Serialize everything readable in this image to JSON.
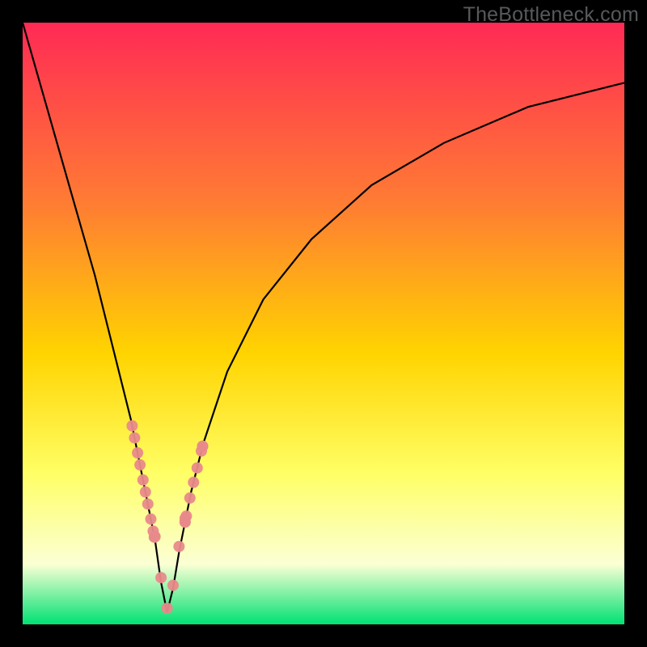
{
  "watermark": "TheBottleneck.com",
  "colors": {
    "top": "#ff2a55",
    "mid_upper": "#ff7c33",
    "mid": "#ffd400",
    "mid_lower": "#ffff66",
    "pale": "#fbffd4",
    "bottom": "#00e173",
    "frame": "#000000",
    "curve": "#000000",
    "dots": "#e98a8a"
  },
  "chart_data": {
    "type": "line",
    "title": "",
    "xlabel": "",
    "ylabel": "",
    "xlim": [
      0,
      100
    ],
    "ylim": [
      0,
      100
    ],
    "notch_x": 24,
    "series": [
      {
        "name": "bottleneck-curve",
        "x": [
          0,
          4,
          8,
          12,
          15,
          18,
          20,
          22,
          23,
          24,
          25,
          26,
          28,
          30,
          34,
          40,
          48,
          58,
          70,
          84,
          100
        ],
        "y": [
          100,
          86,
          72,
          58,
          46,
          34,
          24,
          14,
          7,
          2,
          6,
          12,
          22,
          30,
          42,
          54,
          64,
          73,
          80,
          86,
          90
        ]
      }
    ],
    "marker_clusters": [
      {
        "side": "left",
        "x_range": [
          17,
          22
        ],
        "y_range": [
          11,
          33
        ],
        "count": 11
      },
      {
        "side": "right",
        "x_range": [
          27,
          30
        ],
        "y_range": [
          13,
          34
        ],
        "count": 9
      },
      {
        "side": "floor",
        "x_range": [
          22,
          27
        ],
        "y_range": [
          1,
          5
        ],
        "count": 6
      }
    ]
  }
}
